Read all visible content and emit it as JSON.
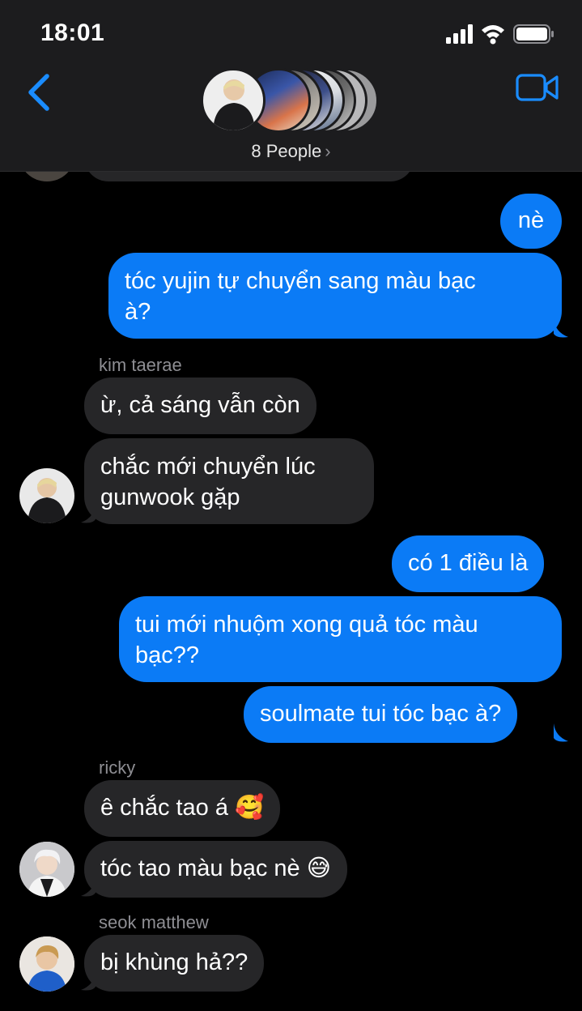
{
  "status": {
    "time": "18:01"
  },
  "header": {
    "people_label": "8 People",
    "people_chevron": "›"
  },
  "icons": {
    "back": "chevron-left-icon",
    "video": "video-camera-icon"
  },
  "colors": {
    "sent": "#0b7bf6",
    "received": "#262628",
    "accent": "#1a8cff"
  },
  "messages": {
    "m1": "nè",
    "m2a": "tóc yujin tự chuyển sang màu bạc",
    "m2b": "à?",
    "sender1": "kim taerae",
    "m3": "ừ, cả sáng vẫn còn",
    "m4a": "chắc mới chuyển lúc",
    "m4b": "gunwook gặp",
    "m5": "có 1 điều là",
    "m6a": "tui mới nhuộm xong quả tóc màu",
    "m6b": "bạc??",
    "m7": "soulmate tui tóc bạc à?",
    "sender2": "ricky",
    "m8": "ê chắc tao á 🥰",
    "m9": "tóc tao màu bạc nè 😅",
    "sender3": "seok matthew",
    "m10": "bị khùng hả??"
  }
}
